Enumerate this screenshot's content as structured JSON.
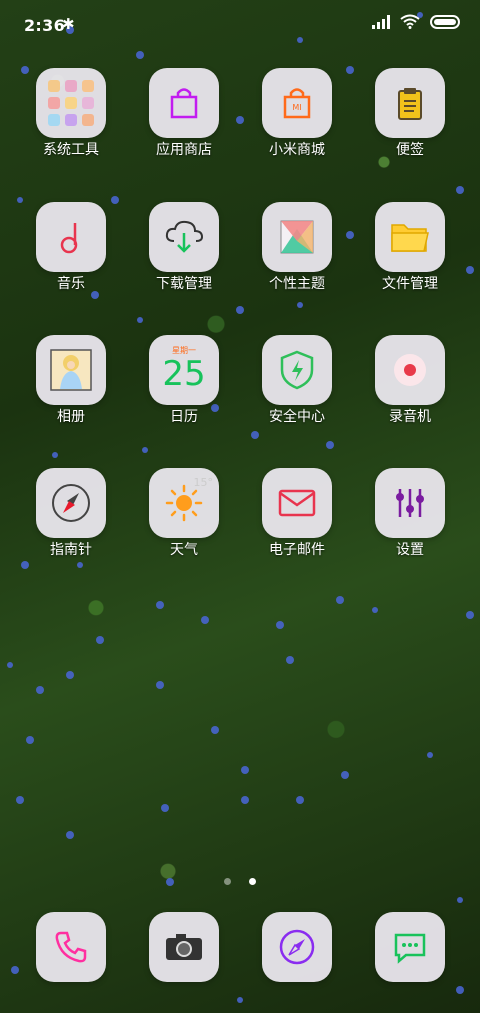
{
  "status_bar": {
    "time": "2:36",
    "bluetooth_glyph": "✱",
    "icons": [
      "signal-icon",
      "wifi-icon",
      "battery-icon"
    ]
  },
  "apps": [
    {
      "label": "系统工具",
      "icon": "folder-icon"
    },
    {
      "label": "应用商店",
      "icon": "shopping-bag-icon"
    },
    {
      "label": "小米商城",
      "icon": "mi-store-bag-icon",
      "badge": "MI"
    },
    {
      "label": "便签",
      "icon": "clipboard-icon"
    },
    {
      "label": "音乐",
      "icon": "music-note-icon"
    },
    {
      "label": "下载管理",
      "icon": "cloud-download-icon"
    },
    {
      "label": "个性主题",
      "icon": "theme-icon"
    },
    {
      "label": "文件管理",
      "icon": "folder-file-icon"
    },
    {
      "label": "相册",
      "icon": "gallery-icon"
    },
    {
      "label": "日历",
      "icon": "calendar-icon",
      "day_label": "星期一",
      "date": "25"
    },
    {
      "label": "安全中心",
      "icon": "shield-bolt-icon"
    },
    {
      "label": "录音机",
      "icon": "record-icon"
    },
    {
      "label": "指南针",
      "icon": "compass-icon"
    },
    {
      "label": "天气",
      "icon": "sun-icon",
      "temp": "15°"
    },
    {
      "label": "电子邮件",
      "icon": "mail-icon"
    },
    {
      "label": "设置",
      "icon": "settings-sliders-icon"
    }
  ],
  "page_indicator": {
    "pages": 2,
    "current": 2
  },
  "dock": [
    {
      "icon": "phone-icon"
    },
    {
      "icon": "camera-icon"
    },
    {
      "icon": "browser-compass-icon"
    },
    {
      "icon": "message-icon"
    }
  ],
  "colors": {
    "store_purple": "#c21cf0",
    "mi_orange": "#ff6a1a",
    "music_red": "#e8344e",
    "calendar_green": "#17c25b",
    "calendar_orange": "#ff6a1a",
    "shield_green": "#2fbf5a",
    "record_red": "#e83a4a",
    "compass_red": "#e8192c",
    "weather_orange": "#ff9d1c",
    "mail_red": "#e8344e",
    "settings_purple": "#7a1ca0",
    "phone_pink": "#ff2fa0",
    "browser_purple": "#8a2cf0",
    "message_green": "#19c25b"
  }
}
